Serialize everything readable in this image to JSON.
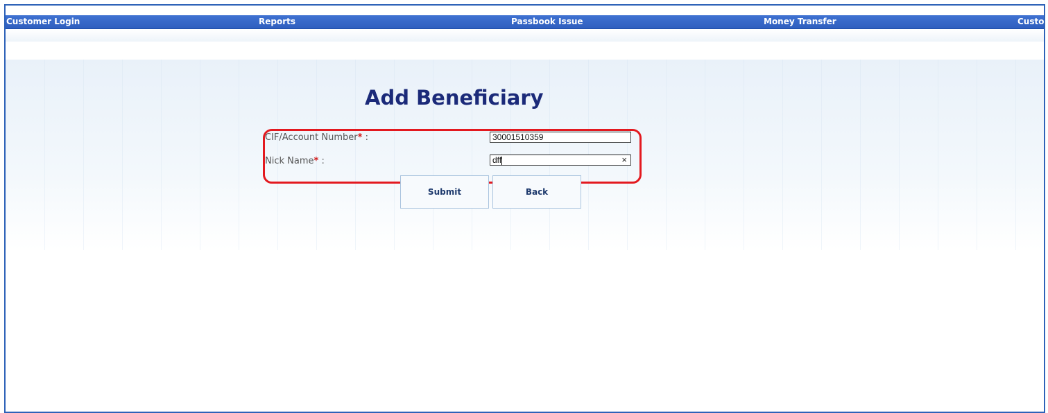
{
  "nav": {
    "items": [
      {
        "label": "Customer Login"
      },
      {
        "label": "Reports"
      },
      {
        "label": "Passbook Issue"
      },
      {
        "label": "Money Transfer"
      },
      {
        "label": "Custo"
      }
    ]
  },
  "page": {
    "title": "Add Beneficiary"
  },
  "form": {
    "cif_label": "CIF/Account Number",
    "cif_required": "*",
    "cif_colon": ":",
    "cif_value": "30001510359",
    "nick_label": "Nick Name",
    "nick_required": "*",
    "nick_colon": ":",
    "nick_value": "dff",
    "clear_glyph": "×"
  },
  "buttons": {
    "submit_label": "Submit",
    "back_label": "Back"
  },
  "colors": {
    "nav_bg": "#3366cc",
    "title": "#1b2a79",
    "highlight": "#e3191f",
    "required": "#d11a1a"
  }
}
